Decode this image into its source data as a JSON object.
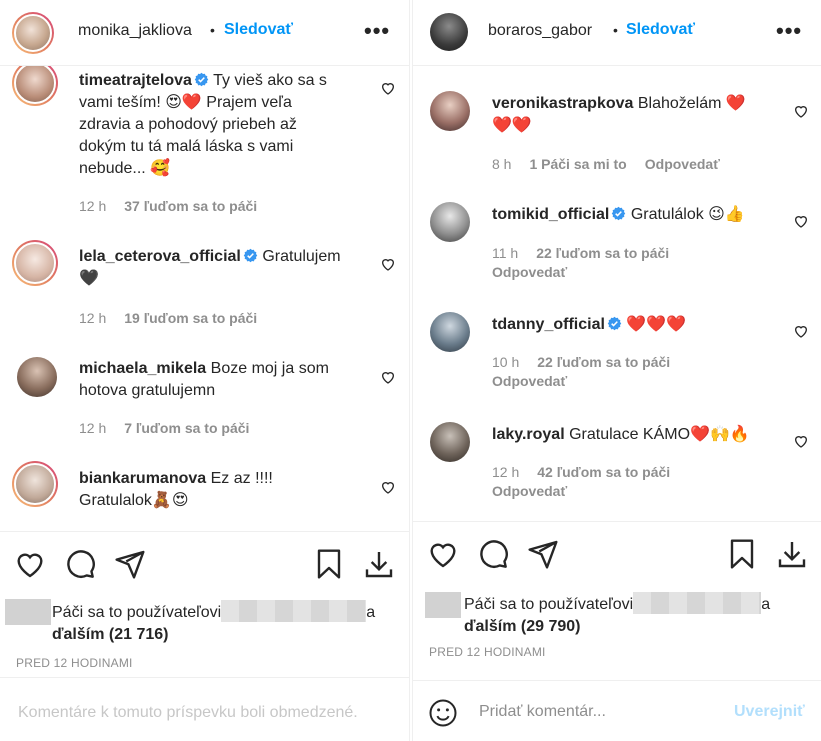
{
  "left": {
    "header": {
      "username": "monika_jakliova",
      "dot": "•",
      "follow_label": "Sledovať",
      "more": "•••"
    },
    "comments": [
      {
        "username": "timeatrajtelova",
        "verified": true,
        "text_lines": [
          "Ty vieš ako sa s",
          "vami teším! 😍❤️ Prajem veľa",
          "zdravia a pohodový priebeh až",
          "dokým tu tá malá láska s vami",
          "nebude... 🥰"
        ],
        "time": "12 h",
        "likes": "37 ľuďom sa to páči"
      },
      {
        "username": "lela_ceterova_official",
        "verified": true,
        "text_lines": [
          "Gratulujem",
          "🖤"
        ],
        "time": "12 h",
        "likes": "19 ľuďom sa to páči"
      },
      {
        "username": "michaela_mikela",
        "verified": false,
        "text_lines": [
          "Boze moj ja som",
          "hotova gratulujemn"
        ],
        "time": "12 h",
        "likes": "7 ľuďom sa to páči"
      },
      {
        "username": "biankarumanova",
        "verified": false,
        "text_lines": [
          "Ez az !!!!",
          "Gratulalok🧸😍"
        ]
      }
    ],
    "liked_by": {
      "prefix": "Páči sa to používateľovi",
      "suffix": "a",
      "others_label": "ďalším",
      "count": "(21 716)"
    },
    "time_caption": "PRED 12 HODINAMI",
    "comment_box": {
      "disabled_text": "Komentáre k tomuto príspevku boli obmedzené."
    }
  },
  "right": {
    "header": {
      "username": "boraros_gabor",
      "dot": "•",
      "follow_label": "Sledovať",
      "more": "•••"
    },
    "comments": [
      {
        "username": "veronikastrapkova",
        "verified": false,
        "text_lines": [
          "Blahoželám ❤️",
          "❤️❤️"
        ],
        "time": "8 h",
        "likes": "1 Páči sa mi to",
        "reply": "Odpovedať"
      },
      {
        "username": "tomikid_official",
        "verified": true,
        "text_lines": [
          "Gratulálok 😉👍"
        ],
        "time": "11 h",
        "likes": "22 ľuďom sa to páči",
        "reply": "Odpovedať"
      },
      {
        "username": "tdanny_official",
        "verified": true,
        "text_lines": [
          "❤️❤️❤️"
        ],
        "time": "10 h",
        "likes": "22 ľuďom sa to páči",
        "reply": "Odpovedať"
      },
      {
        "username": "laky.royal",
        "verified": false,
        "text_lines": [
          "Gratulace KÁMO❤️🙌🔥"
        ],
        "time": "12 h",
        "likes": "42 ľuďom sa to páči",
        "reply": "Odpovedať"
      }
    ],
    "liked_by": {
      "prefix": "Páči sa to používateľovi",
      "suffix": "a",
      "others_label": "ďalším",
      "count": "(29 790)"
    },
    "time_caption": "PRED 12 HODINAMI",
    "comment_box": {
      "placeholder": "Pridať komentár...",
      "post_label": "Uverejniť"
    }
  },
  "colors": {
    "accent": "#0095f6",
    "verified": "#3897f0",
    "heart_red": "#e8112d",
    "muted": "#8e8e8e",
    "text": "#262626"
  },
  "icons": [
    "heart-icon",
    "comment-icon",
    "share-icon",
    "bookmark-icon",
    "download-icon",
    "verified-badge-icon",
    "emoji-smile-icon",
    "more-icon"
  ]
}
